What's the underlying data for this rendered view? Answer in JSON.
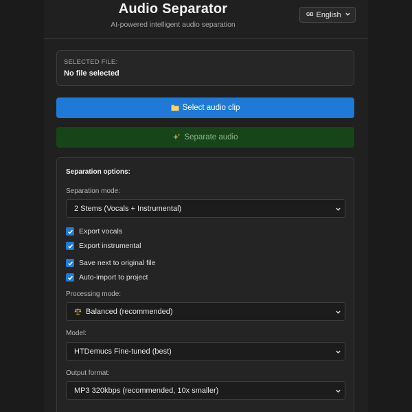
{
  "header": {
    "title": "Audio Separator",
    "subtitle": "AI-powered intelligent audio separation",
    "language": {
      "flag": "GB",
      "selected": "English"
    }
  },
  "file": {
    "label": "SELECTED FILE:",
    "value": "No file selected"
  },
  "actions": {
    "select_label": "Select audio clip",
    "select_icon": "folder-icon",
    "separate_label": "Separate audio",
    "separate_icon": "sparkles-icon"
  },
  "options": {
    "heading": "Separation options:",
    "separation_mode": {
      "label": "Separation mode:",
      "selected": "2 Stems (Vocals + Instrumental)"
    },
    "checkboxes": [
      {
        "label": "Export vocals",
        "checked": true
      },
      {
        "label": "Export instrumental",
        "checked": true
      },
      {
        "label": "Save next to original file",
        "checked": true
      },
      {
        "label": "Auto-import to project",
        "checked": true
      }
    ],
    "processing_mode": {
      "label": "Processing mode:",
      "selected": "Balanced (recommended)",
      "icon": "scales-icon"
    },
    "model": {
      "label": "Model:",
      "selected": "HTDemucs Fine-tuned (best)"
    },
    "output_format": {
      "label": "Output format:",
      "selected": "MP3 320kbps (recommended, 10x smaller)"
    }
  },
  "colors": {
    "accent_blue": "#1e7ad6",
    "separate_green": "#17451a",
    "background": "#1b1b1b",
    "panel": "#202020"
  }
}
